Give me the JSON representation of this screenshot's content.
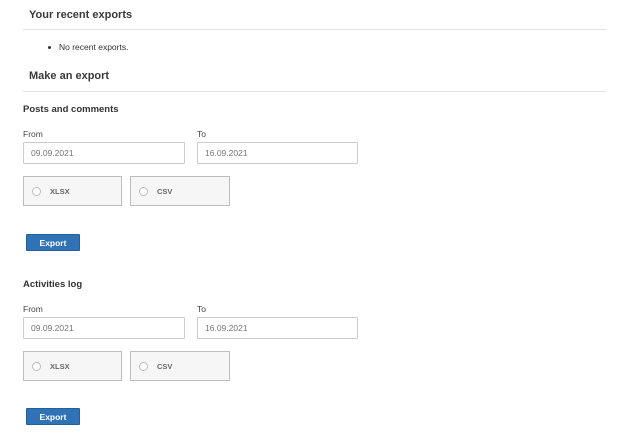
{
  "recent": {
    "title": "Your recent exports",
    "items": [
      "No recent exports."
    ]
  },
  "make_export": {
    "title": "Make an export"
  },
  "sections": [
    {
      "title": "Posts and comments",
      "from_label": "From",
      "to_label": "To",
      "from_value": "09.09.2021",
      "to_value": "16.09.2021",
      "formats": [
        "XLSX",
        "CSV"
      ],
      "button": "Export"
    },
    {
      "title": "Activities log",
      "from_label": "From",
      "to_label": "To",
      "from_value": "09.09.2021",
      "to_value": "16.09.2021",
      "formats": [
        "XLSX",
        "CSV"
      ],
      "button": "Export"
    }
  ],
  "colors": {
    "button_bg": "#2f72b6",
    "rule": "#e3e3e3"
  }
}
